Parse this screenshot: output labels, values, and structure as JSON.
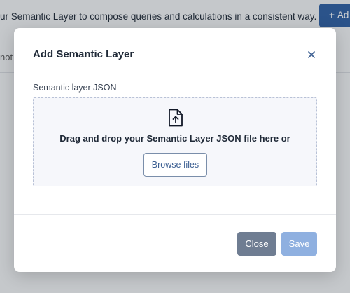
{
  "background": {
    "description": "ur Semantic Layer to compose queries and calculations in a consistent way.",
    "add_button_label": "Ad",
    "row_text": "not"
  },
  "modal": {
    "title": "Add Semantic Layer",
    "close_icon": "×",
    "field_label": "Semantic layer JSON",
    "dropzone": {
      "icon": "file-upload-icon",
      "text": "Drag and drop your Semantic Layer JSON file here or",
      "browse_label": "Browse files"
    },
    "footer": {
      "close_label": "Close",
      "save_label": "Save"
    }
  },
  "colors": {
    "primary": "#2f5fa3",
    "save_disabled": "#8fb0e0",
    "close_button": "#6f7d92"
  }
}
